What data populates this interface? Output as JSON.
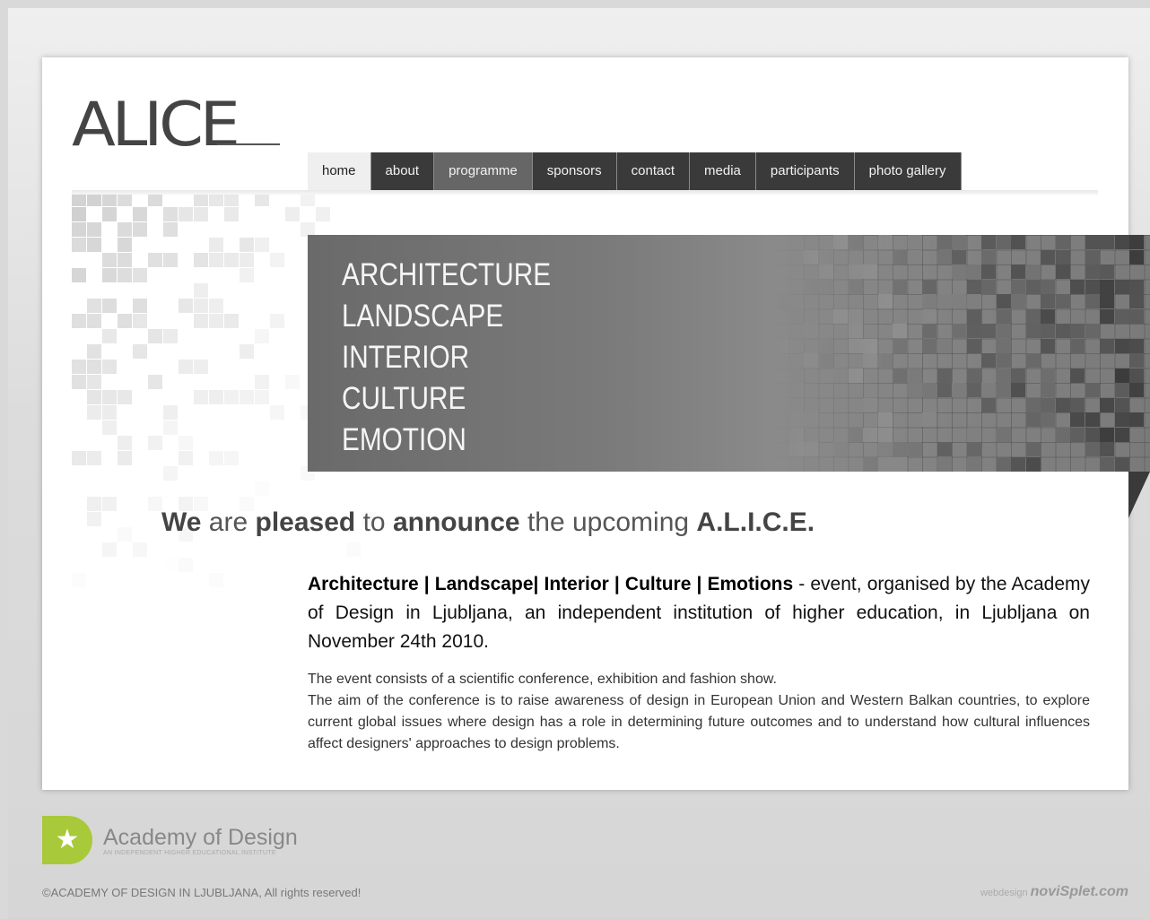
{
  "logo": {
    "text": "ALICE"
  },
  "nav": [
    {
      "label": "home",
      "state": "active"
    },
    {
      "label": "about",
      "state": "normal"
    },
    {
      "label": "programme",
      "state": "alt"
    },
    {
      "label": "sponsors",
      "state": "normal"
    },
    {
      "label": "contact",
      "state": "normal"
    },
    {
      "label": "media",
      "state": "normal"
    },
    {
      "label": "participants",
      "state": "normal"
    },
    {
      "label": "photo gallery",
      "state": "normal"
    }
  ],
  "banner": {
    "words": [
      "ARCHITECTURE",
      "LANDSCAPE",
      "INTERIOR",
      "CULTURE",
      "EMOTION"
    ]
  },
  "headline": {
    "w1": "We",
    "t1": " are ",
    "w2": "pleased",
    "t2": " to ",
    "w3": "announce",
    "t3": " the upcoming ",
    "w4": "A.L.I.C.E."
  },
  "lead": {
    "bold": "Architecture | Landscape| Interior | Culture | Emotions",
    "rest": " - event, organised by the Academy of Design in Ljubljana, an independent institution of higher education, in Ljubljana on November 24th 2010."
  },
  "body": {
    "line1": "The event consists of a scientific conference, exhibition and fashion show.",
    "line2": "The aim of the conference is to raise awareness of design in European Union and Western Balkan countries, to explore current global issues where design has a role in determining future outcomes and to understand how cultural influences affect designers' approaches to design problems."
  },
  "footer": {
    "academy_name": "Academy of Design",
    "academy_sub": "AN INDEPENDENT HIGHER EDUCATIONAL INSTITUTE",
    "copyright": "©ACADEMY OF DESIGN IN LJUBLJANA, All rights reserved!",
    "webdesign_label": "webdesign",
    "webdesign_brand": "noviSplet.com"
  },
  "colors": {
    "accent": "#a8c93a",
    "nav_dark": "#3a3a3a",
    "banner": "#7a7a7a"
  },
  "icons": {
    "academy_mark": "star-icon"
  }
}
